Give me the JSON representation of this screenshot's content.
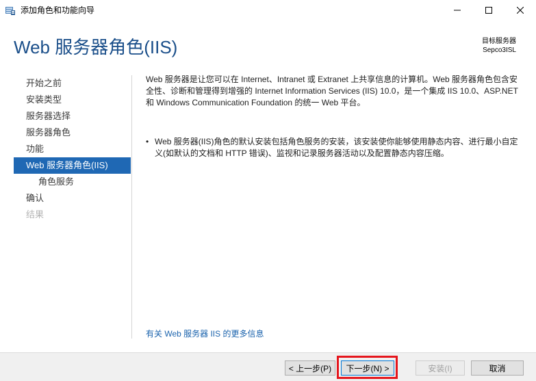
{
  "window": {
    "title": "添加角色和功能向导",
    "minimize_icon": "minimize-icon",
    "maximize_icon": "maximize-icon",
    "close_icon": "close-icon"
  },
  "header": {
    "page_title": "Web 服务器角色(IIS)",
    "target_label": "目标服务器",
    "target_name": "Sepco3ISL"
  },
  "sidebar": {
    "items": [
      {
        "label": "开始之前",
        "state": "normal"
      },
      {
        "label": "安装类型",
        "state": "normal"
      },
      {
        "label": "服务器选择",
        "state": "normal"
      },
      {
        "label": "服务器角色",
        "state": "normal"
      },
      {
        "label": "功能",
        "state": "normal"
      },
      {
        "label": "Web 服务器角色(IIS)",
        "state": "active"
      },
      {
        "label": "角色服务",
        "state": "sub"
      },
      {
        "label": "确认",
        "state": "normal"
      },
      {
        "label": "结果",
        "state": "disabled"
      }
    ]
  },
  "main": {
    "description": "Web 服务器是让您可以在 Internet、Intranet 或 Extranet 上共享信息的计算机。Web 服务器角色包含安全性、诊断和管理得到增强的 Internet Information Services (IIS) 10.0，是一个集成 IIS 10.0、ASP.NET 和 Windows Communication Foundation 的统一 Web 平台。",
    "bullet_symbol": "•",
    "bullet": "Web 服务器(IIS)角色的默认安装包括角色服务的安装，该安装使你能够使用静态内容、进行最小自定义(如默认的文档和 HTTP 错误)、监视和记录服务器活动以及配置静态内容压缩。",
    "more_info_link": "有关 Web 服务器 IIS 的更多信息"
  },
  "footer": {
    "prev_label": "< 上一步(P)",
    "next_label": "下一步(N) >",
    "install_label": "安装(I)",
    "cancel_label": "取消"
  },
  "colors": {
    "accent": "#1f68b4",
    "title_blue": "#1b4f8a",
    "highlight_red": "#e5151c"
  }
}
